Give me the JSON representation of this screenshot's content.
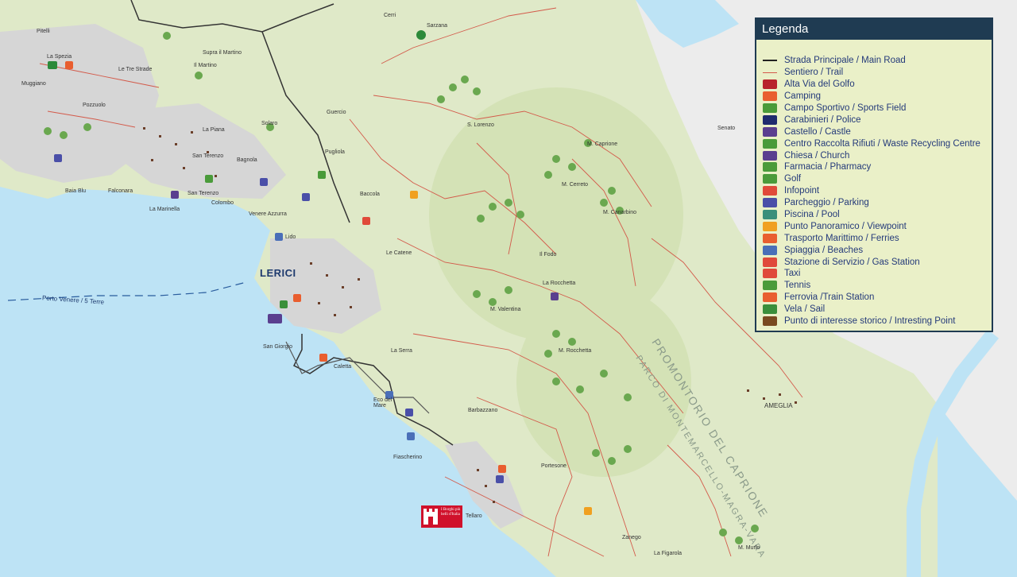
{
  "legend": {
    "title": "Legenda",
    "items": [
      {
        "label": "Strada Principale / Main Road",
        "icon": "main-road-line",
        "color": "#222222"
      },
      {
        "label": "Sentiero / Trail",
        "icon": "trail-line",
        "color": "#d35a4a"
      },
      {
        "label": "Alta Via del Golfo",
        "icon": "alta-via-icon",
        "color": "#b8222b"
      },
      {
        "label": "Camping",
        "icon": "camping-icon",
        "color": "#e95e2f"
      },
      {
        "label": "Campo Sportivo / Sports Field",
        "icon": "sports-field-icon",
        "color": "#4a9b3a"
      },
      {
        "label": "Carabinieri / Police",
        "icon": "police-icon",
        "color": "#1f2b6e"
      },
      {
        "label": "Castello / Castle",
        "icon": "castle-icon",
        "color": "#5a3f8f"
      },
      {
        "label": "Centro Raccolta Rifiuti / Waste Recycling Centre",
        "icon": "recycling-icon",
        "color": "#4a9b3a"
      },
      {
        "label": "Chiesa / Church",
        "icon": "church-icon",
        "color": "#5a3f8f"
      },
      {
        "label": "Farmacia / Pharmacy",
        "icon": "pharmacy-icon",
        "color": "#4a9b3a"
      },
      {
        "label": "Golf",
        "icon": "golf-icon",
        "color": "#4a9b3a"
      },
      {
        "label": "Infopoint",
        "icon": "infopoint-icon",
        "color": "#e04a3a"
      },
      {
        "label": "Parcheggio / Parking",
        "icon": "parking-icon",
        "color": "#4a4fa8"
      },
      {
        "label": "Piscina / Pool",
        "icon": "pool-icon",
        "color": "#3a8f7a"
      },
      {
        "label": "Punto Panoramico / Viewpoint",
        "icon": "viewpoint-icon",
        "color": "#f0a020"
      },
      {
        "label": "Trasporto Marittimo / Ferries",
        "icon": "ferry-icon",
        "color": "#e95e2f"
      },
      {
        "label": "Spiaggia / Beaches",
        "icon": "beach-icon",
        "color": "#4a6fb8"
      },
      {
        "label": "Stazione di Servizio / Gas Station",
        "icon": "gas-station-icon",
        "color": "#e04a3a"
      },
      {
        "label": "Taxi",
        "icon": "taxi-icon",
        "color": "#e04a3a"
      },
      {
        "label": "Tennis",
        "icon": "tennis-icon",
        "color": "#4a9b3a"
      },
      {
        "label": "Ferrovia /Train Station",
        "icon": "train-station-icon",
        "color": "#e95e2f"
      },
      {
        "label": "Vela / Sail",
        "icon": "sail-icon",
        "color": "#3a8f3a"
      },
      {
        "label": "Punto di interesse storico / Intresting Point",
        "icon": "historic-point-icon",
        "color": "#7a4a20"
      }
    ]
  },
  "places": {
    "lerici": "LERICI",
    "ameglia": "AMEGLIA",
    "la_spezia": "La Spezia",
    "sarzana": "Sarzana",
    "pitelli": "Pitelli",
    "cerri": "Cerri",
    "le_tre_strade": "Le Tre Strade",
    "muggiano": "Muggiano",
    "pozzuolo": "Pozzuolo",
    "la_piana": "La Piana",
    "san_terenzo": "San Terenzo",
    "san_terenzo_2": "San Terenzo",
    "bagnola": "Bagnola",
    "solaro": "Solaro",
    "pugliola": "Pugliola",
    "guercio": "Guercio",
    "baccola": "Baccola",
    "la_marinella": "La Marinella",
    "colombo": "Colombo",
    "venere_azzurra": "Venere Azzurra",
    "lido": "Lido",
    "le_catene": "Le Catene",
    "il_fodo": "Il Fodo",
    "la_rocchetta": "La Rocchetta",
    "la_serra": "La Serra",
    "san_giorgio": "San Giorgio",
    "caletta": "Caletta",
    "eco_del_mare": "Eco del Mare",
    "fiascherino": "Fiascherino",
    "tellaro": "Tellaro",
    "portesone": "Portesone",
    "zanego": "Zanego",
    "barbazzano": "Barbazzano",
    "senato": "Senato",
    "supra_il_martino": "Supra il Martino",
    "il_martino": "Il Martino",
    "s_lorenzo": "S. Lorenzo",
    "baia_blu": "Baia Blu",
    "falconara": "Falconara",
    "porto_venere": "Porto Venere / 5 Terre",
    "la_figarola": "La Figarola",
    "m_caprione": "M. Caprione",
    "m_rocchetta": "M. Rocchetta",
    "m_canarbino": "M. Canarbino",
    "m_valentina": "M. Valentina",
    "m_cerreto": "M. Cerreto",
    "m_murlo": "M. Murlo",
    "park_name_1": "PROMONTORIO DEL CAPRIONE",
    "park_name_2": "PARCO DI MONTEMARCELLO-MAGRA-VARA"
  },
  "borghi_badge": "I Borghi più belli d'Italia"
}
